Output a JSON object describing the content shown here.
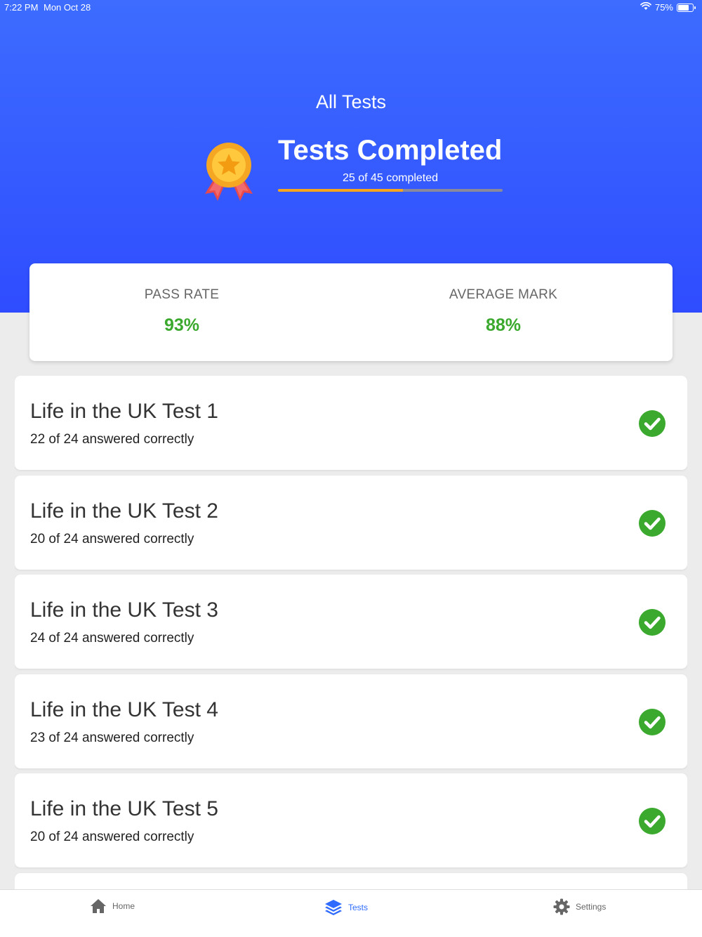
{
  "status_bar": {
    "time": "7:22 PM",
    "date": "Mon Oct 28",
    "battery": "75%",
    "battery_level": 0.75,
    "icons": [
      "wifi-icon",
      "battery-icon"
    ]
  },
  "header": {
    "title": "All Tests",
    "completed_title": "Tests Completed",
    "completed_sub": "25 of 45 completed",
    "progress": 0.556,
    "colors": {
      "background_top": "#3d6cff",
      "background_bottom": "#2f4dff",
      "progress": "#f7a51c",
      "track": "#8a8a9a"
    },
    "icon": "medal-icon"
  },
  "stats": {
    "pass_rate_label": "PASS RATE",
    "pass_rate_value": "93%",
    "average_mark_label": "AVERAGE MARK",
    "average_mark_value": "88%",
    "value_color": "#3aa92d"
  },
  "tests": [
    {
      "title": "Life in the UK Test 1",
      "result": "22 of 24 answered correctly",
      "status_icon": "check-circle-icon"
    },
    {
      "title": "Life in the UK Test 2",
      "result": "20 of 24 answered correctly",
      "status_icon": "check-circle-icon"
    },
    {
      "title": "Life in the UK Test 3",
      "result": "24 of 24 answered correctly",
      "status_icon": "check-circle-icon"
    },
    {
      "title": "Life in the UK Test 4",
      "result": "23 of 24 answered correctly",
      "status_icon": "check-circle-icon"
    },
    {
      "title": "Life in the UK Test 5",
      "result": "20 of 24 answered correctly",
      "status_icon": "check-circle-icon"
    }
  ],
  "tab_bar": {
    "items": [
      {
        "label": "Home",
        "icon": "home-icon",
        "active": false
      },
      {
        "label": "Tests",
        "icon": "layers-icon",
        "active": true
      },
      {
        "label": "Settings",
        "icon": "gear-icon",
        "active": false
      }
    ],
    "active_color": "#2f6bff"
  }
}
